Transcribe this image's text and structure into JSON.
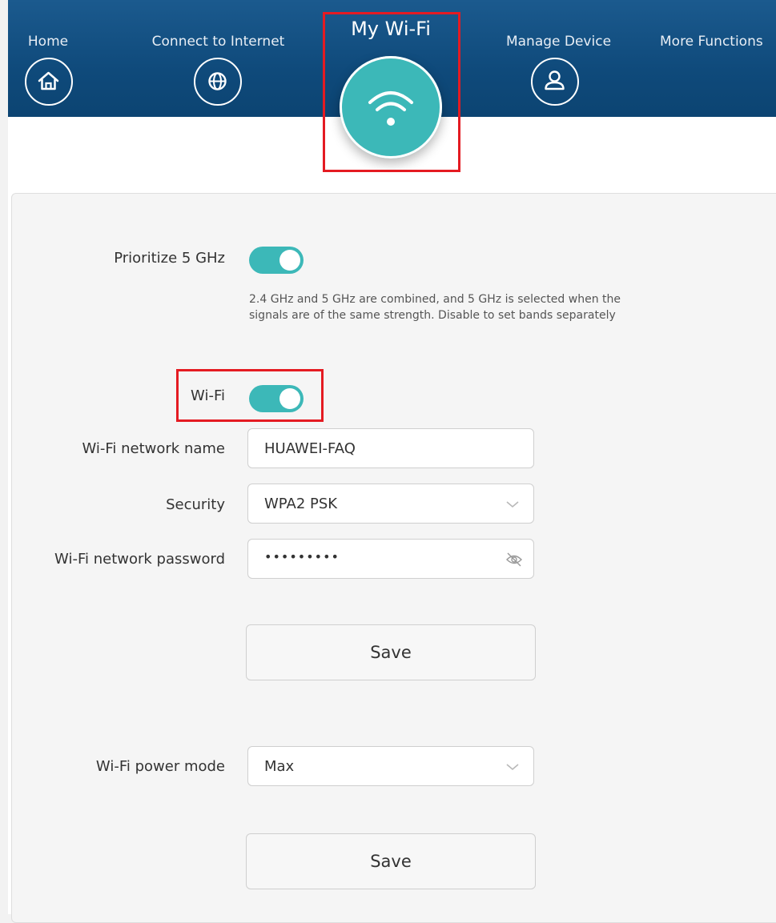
{
  "nav": {
    "items": [
      {
        "label": "Home",
        "icon": "home-icon"
      },
      {
        "label": "Connect to Internet",
        "icon": "globe-icon"
      },
      {
        "label": "My Wi-Fi",
        "icon": "wifi-icon",
        "active": true
      },
      {
        "label": "Manage Device",
        "icon": "user-icon"
      },
      {
        "label": "More Functions",
        "icon": "menu-icon"
      }
    ],
    "bar_color": "#0f4a7b",
    "accent_color": "#3cb8b8"
  },
  "settings": {
    "prioritize_5ghz": {
      "label": "Prioritize 5 GHz",
      "enabled": true,
      "hint": "2.4 GHz and 5 GHz are combined, and 5 GHz is selected when the signals are of the same strength. Disable to set bands separately"
    },
    "wifi": {
      "label": "Wi-Fi",
      "enabled": true
    },
    "network_name": {
      "label": "Wi-Fi network name",
      "value": "HUAWEI-FAQ"
    },
    "security": {
      "label": "Security",
      "value": "WPA2 PSK"
    },
    "password": {
      "label": "Wi-Fi network password",
      "value": "•••••••••"
    },
    "save_label": "Save",
    "power_mode": {
      "label": "Wi-Fi power mode",
      "value": "Max"
    },
    "save_label_2": "Save"
  },
  "highlight_color": "#e41b22"
}
